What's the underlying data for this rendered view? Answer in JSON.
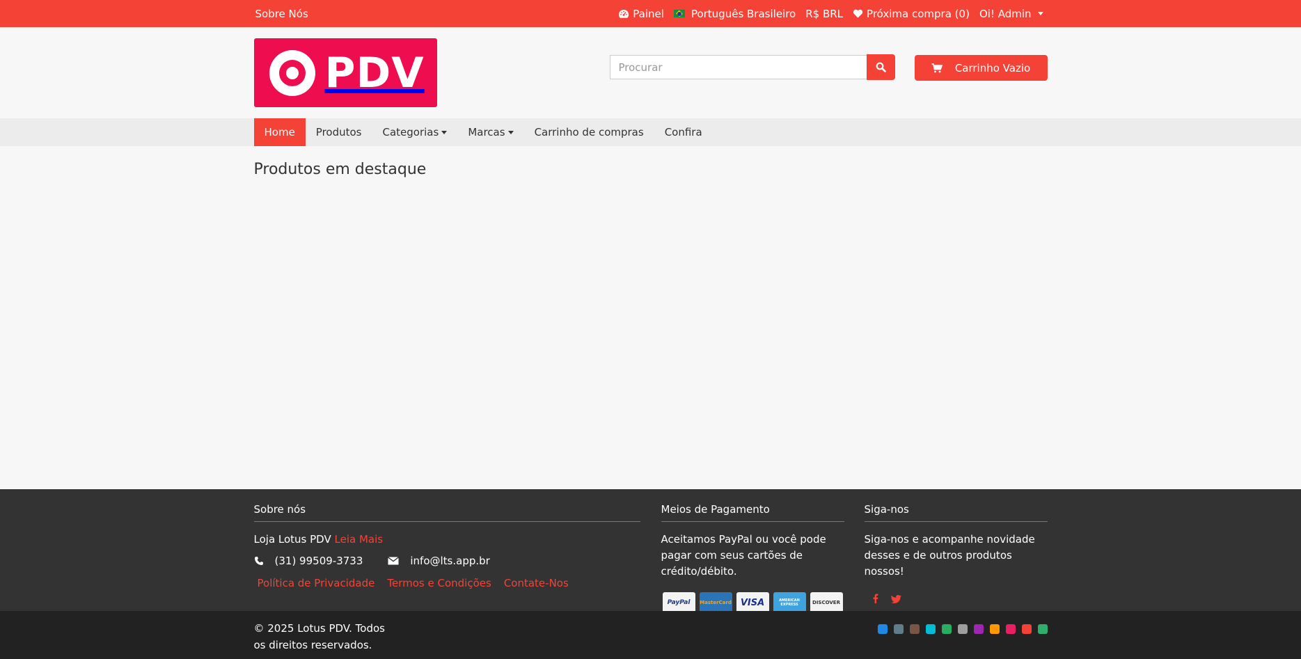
{
  "topbar": {
    "about": "Sobre Nós",
    "panel": "Painel",
    "language": "Português Brasileiro",
    "currency": "R$ BRL",
    "wishlist": "Próxima compra (0)",
    "user": "Oi! Admin"
  },
  "header": {
    "logo_text": "PDV",
    "search_placeholder": "Procurar",
    "cart_label": "Carrinho Vazio"
  },
  "nav": {
    "items": [
      {
        "label": "Home"
      },
      {
        "label": "Produtos"
      },
      {
        "label": "Categorias"
      },
      {
        "label": "Marcas"
      },
      {
        "label": "Carrinho de compras"
      },
      {
        "label": "Confira"
      }
    ]
  },
  "main": {
    "title": "Produtos em destaque"
  },
  "footer": {
    "about": {
      "heading": "Sobre nós",
      "store": "Loja Lotus PDV",
      "read_more": "Leia Mais",
      "phone": "(31) 99509-3733",
      "email": "info@lts.app.br",
      "links": [
        "Política de Privacidade",
        "Termos e Condições",
        "Contate-Nos"
      ]
    },
    "payment": {
      "heading": "Meios de Pagamento",
      "text": "Aceitamos PayPal ou você pode pagar com seus cartões de crédito/débito.",
      "cards": [
        "PayPal",
        "MasterCard",
        "VISA",
        "AMERICAN EXPRESS",
        "DISCOVER"
      ]
    },
    "social": {
      "heading": "Siga-nos",
      "text": "Siga-nos e acompanhe novidade desses e de outros produtos nossos!"
    }
  },
  "bottombar": {
    "copyright": "© 2025 Lotus PDV. Todos os direitos reservados.",
    "swatches": [
      "#1e88e5",
      "#607d8b",
      "#795548",
      "#00bcd4",
      "#27ae60",
      "#9e9e9e",
      "#9c27b0",
      "#ff9800",
      "#e91e63",
      "#f44336",
      "#2eae6a"
    ]
  },
  "colors": {
    "accent": "#f44336",
    "logo_bg": "#ee0d4f",
    "footer_bg": "#333333",
    "bottombar_bg": "#222222"
  }
}
